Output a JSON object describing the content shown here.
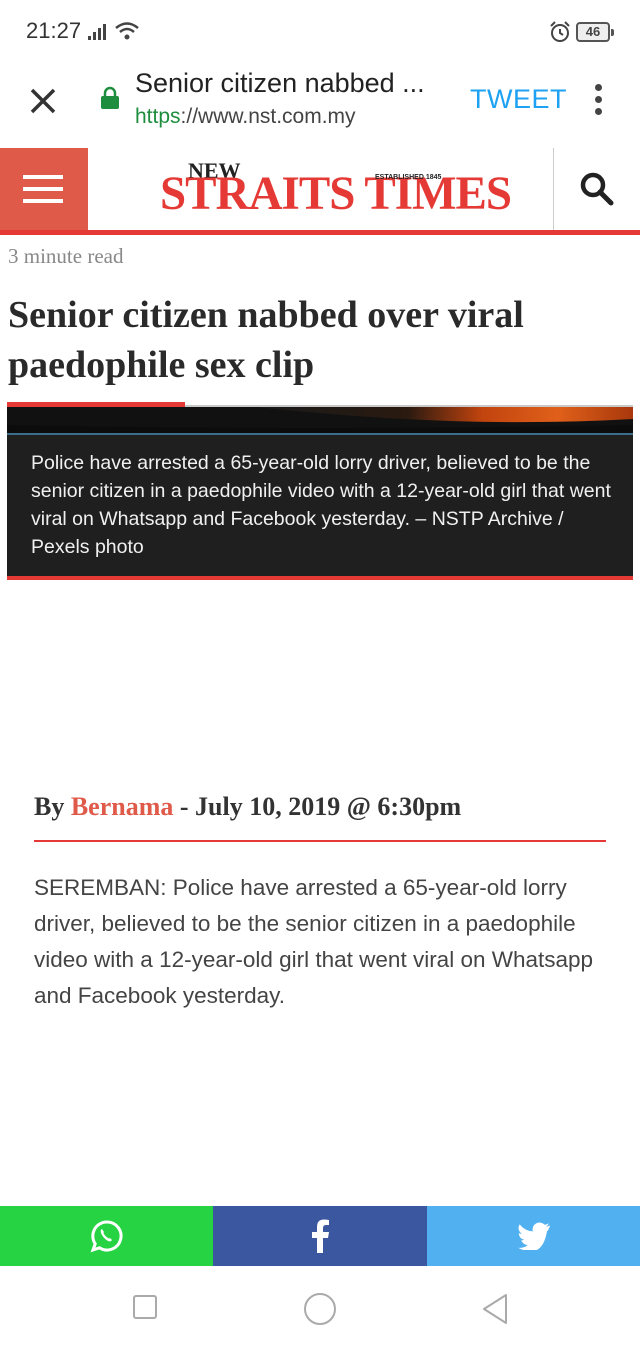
{
  "status_bar": {
    "time": "21:27",
    "battery": "46",
    "icons": [
      "signal-icon",
      "wifi-icon",
      "alarm-icon",
      "battery-icon"
    ]
  },
  "custom_tab": {
    "title": "Senior citizen nabbed ...",
    "url_scheme": "https",
    "url_rest": "://www.nst.com.my",
    "tweet_label": "TWEET",
    "icons": [
      "close-icon",
      "lock-icon",
      "more-vertical-icon"
    ]
  },
  "site_header": {
    "logo_small": "NEW",
    "logo_main": "STRAITS TIMES",
    "logo_established": "ESTABLISHED 1845",
    "icons": [
      "menu-icon",
      "search-icon"
    ]
  },
  "article": {
    "read_time": "3 minute read",
    "headline": "Senior citizen nabbed over viral paedophile sex clip",
    "caption": "Police have arrested a 65-year-old lorry driver, believed to be the senior citizen in a paedophile video with a 12-year-old girl that went viral on Whatsapp and Facebook yesterday. – NSTP Archive / Pexels photo",
    "byline_prefix": "By",
    "author": "Bernama",
    "date": "- July 10, 2019 @ 6:30pm",
    "body": "SEREMBAN: Police have arrested a 65-year-old lorry driver, believed to be the senior citizen in a paedophile video with a 12-year-old girl that went viral on Whatsapp and Facebook yesterday."
  },
  "share_bar": {
    "buttons": [
      "whatsapp-icon",
      "facebook-icon",
      "twitter-icon"
    ],
    "colors": {
      "whatsapp": "#25d343",
      "facebook": "#3b57a0",
      "twitter": "#51b0f0"
    }
  },
  "nav_bar": {
    "icons": [
      "recents-icon",
      "home-icon",
      "back-icon"
    ]
  },
  "colors": {
    "brand_red": "#e53935",
    "tweet_blue": "#1da1f2",
    "secure_green": "#1e8e3e"
  }
}
